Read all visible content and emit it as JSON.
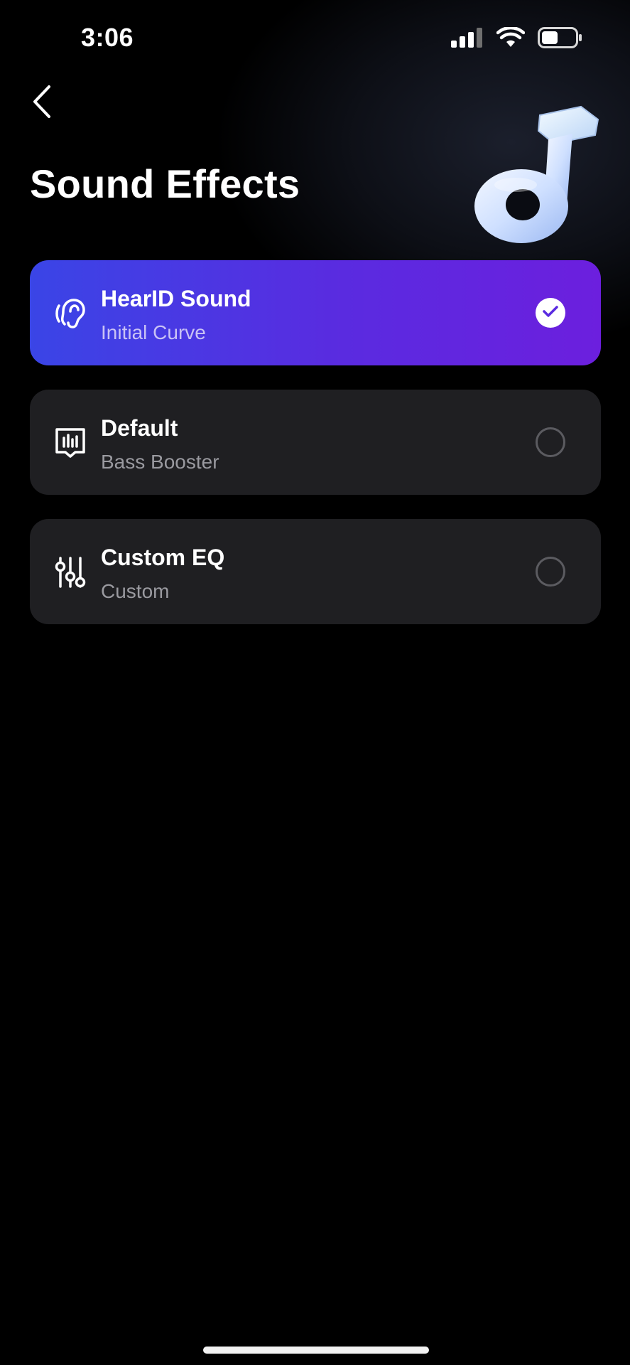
{
  "status_bar": {
    "time": "3:06",
    "icons": [
      "cellular-signal-icon",
      "wifi-icon",
      "battery-icon"
    ]
  },
  "header": {
    "back_icon": "chevron-left-icon",
    "title": "Sound Effects",
    "hero_icon": "music-note-icon"
  },
  "options": [
    {
      "title": "HearID Sound",
      "subtitle": "Initial Curve",
      "icon": "ear-icon",
      "selected": true
    },
    {
      "title": "Default",
      "subtitle": "Bass Booster",
      "icon": "equalizer-bars-icon",
      "selected": false
    },
    {
      "title": "Custom EQ",
      "subtitle": "Custom",
      "icon": "sliders-icon",
      "selected": false
    }
  ],
  "colors": {
    "background": "#000000",
    "card": "#1f1f22",
    "selected_gradient_start": "#3a45e6",
    "selected_gradient_end": "#6c1fde",
    "accent_check": "#5a2be0"
  }
}
